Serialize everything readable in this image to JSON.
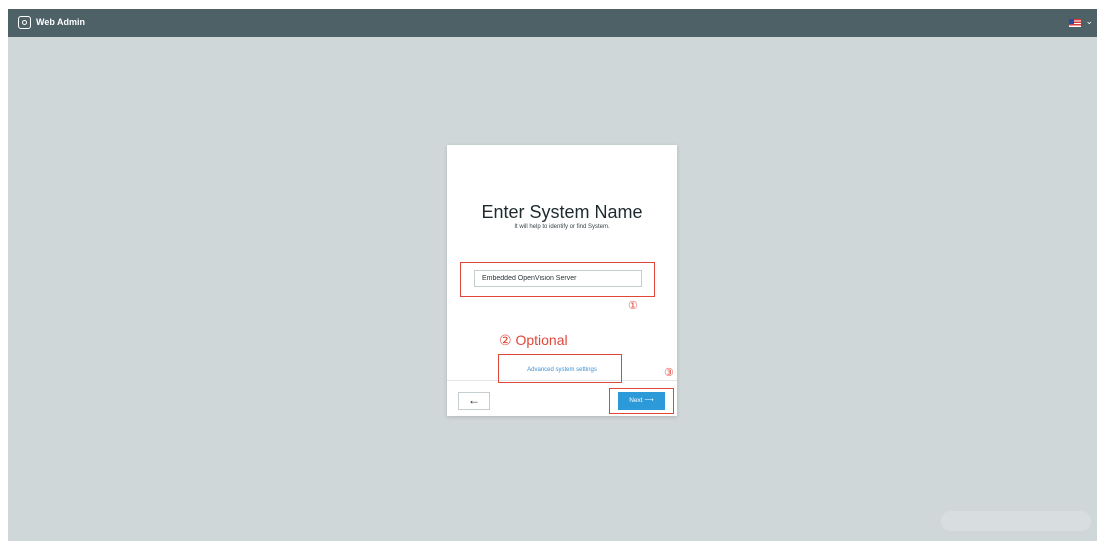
{
  "app": {
    "title": "Web Admin",
    "logo_icon": "app-logo-icon"
  },
  "header": {
    "language_flag": "us-flag-icon",
    "language_chevron": "chevron-down-icon"
  },
  "dialog": {
    "title": "Enter System Name",
    "subtitle": "It will help to identify or find System.",
    "system_name_value": "Embedded OpenVision Server",
    "advanced_link": "Advanced system settings",
    "back_label": "←",
    "next_label": "Next ⟶"
  },
  "annotations": {
    "one": "①",
    "two": "② Optional",
    "three": "③",
    "highlight_color": "#e0463a"
  },
  "colors": {
    "topbar": "#4e6167",
    "background": "#d0d7d9",
    "accent": "#2c9ad9",
    "link": "#3f8fd2"
  }
}
